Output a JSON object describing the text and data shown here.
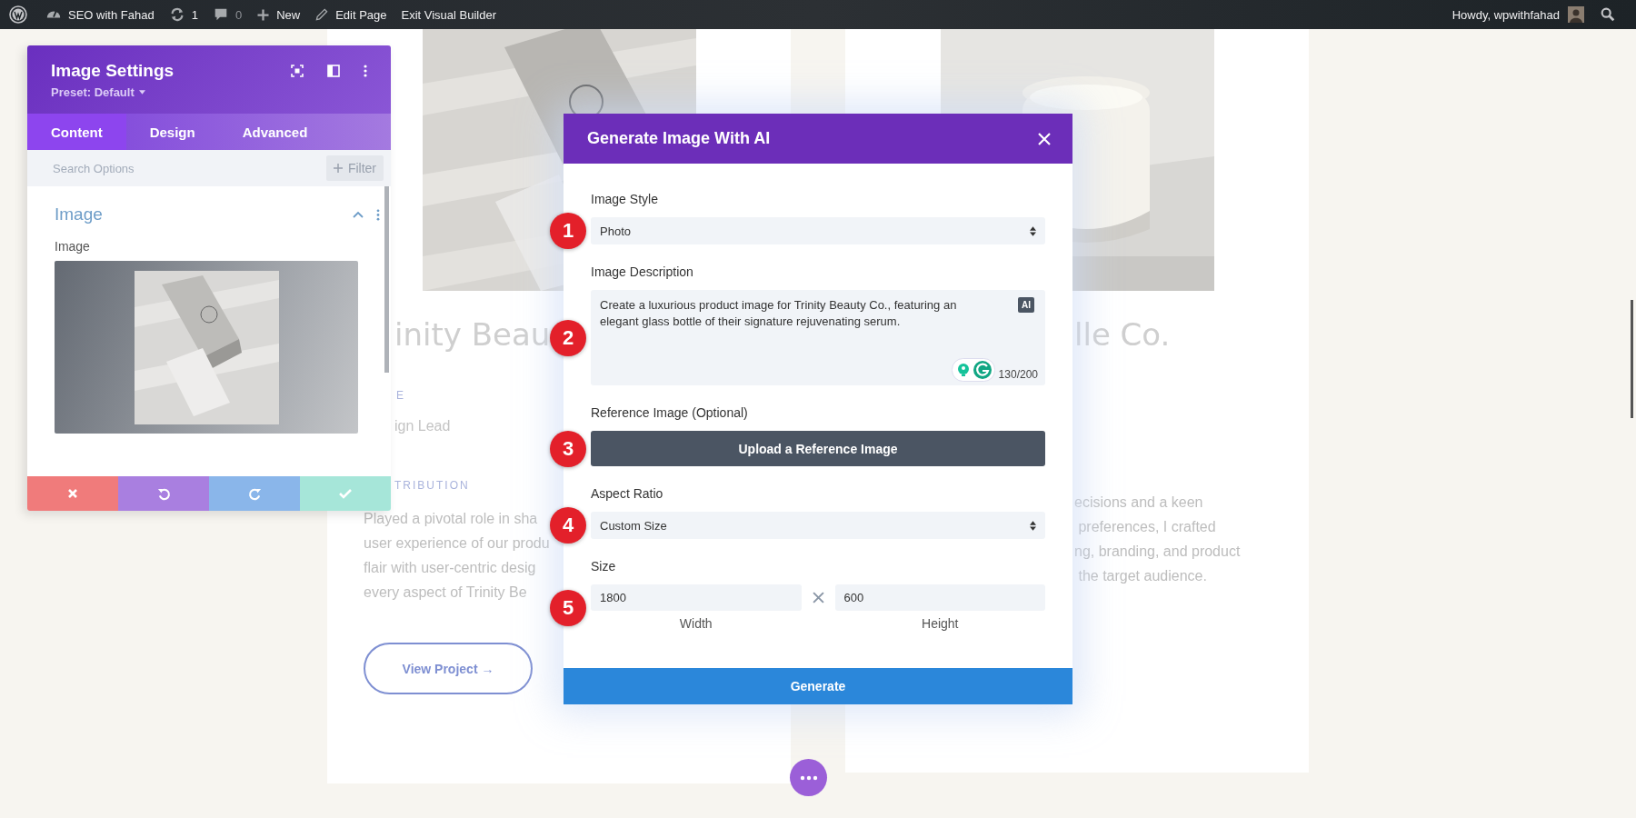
{
  "admin_bar": {
    "items": [
      {
        "kind": "site",
        "label": "SEO with Fahad",
        "disabled": false
      },
      {
        "kind": "updates",
        "label": "1",
        "disabled": false
      },
      {
        "kind": "comments",
        "label": "0",
        "disabled": true
      },
      {
        "kind": "new",
        "label": "New",
        "disabled": false
      },
      {
        "kind": "edit",
        "label": "Edit Page",
        "disabled": false
      },
      {
        "kind": "exit",
        "label": "Exit Visual Builder",
        "disabled": false
      }
    ],
    "greeting": "Howdy, wpwithfahad"
  },
  "page": {
    "cards": [
      {
        "title": "inity Beau",
        "label": "E",
        "role": "ign Lead",
        "section": "TRIBUTION",
        "paragraph_lines": [
          "Played a pivotal role in sha",
          "user experience of our produ",
          "flair with user-centric desig",
          "every aspect of Trinity Be"
        ],
        "button": "View Project →"
      },
      {
        "title": "lle Co.",
        "paragraph_lines": [
          "ecisions and a keen",
          " preferences, I crafted",
          "ng, branding, and product",
          " the target audience."
        ]
      }
    ]
  },
  "settings_panel": {
    "title": "Image Settings",
    "preset": "Preset: Default",
    "tabs": [
      {
        "label": "Content",
        "selected": true
      },
      {
        "label": "Design",
        "selected": false
      },
      {
        "label": "Advanced",
        "selected": false
      }
    ],
    "search": {
      "placeholder": "Search Options"
    },
    "filter": "Filter",
    "section": {
      "title": "Image",
      "expanded": true
    },
    "field_label": "Image",
    "footer": [
      {
        "kind": "discard"
      },
      {
        "kind": "undo"
      },
      {
        "kind": "redo"
      },
      {
        "kind": "save"
      }
    ]
  },
  "modal": {
    "title": "Generate Image With AI",
    "fields": [
      {
        "kind": "select",
        "step": "1",
        "label": "Image Style",
        "value": "Photo"
      },
      {
        "kind": "textarea",
        "step": "2",
        "label": "Image Description",
        "value": "Create a luxurious product image for Trinity Beauty Co., featuring an elegant glass bottle of their signature rejuvenating serum.",
        "badge": "AI",
        "counter": "130/200"
      },
      {
        "kind": "upload",
        "step": "3",
        "label": "Reference Image (Optional)",
        "button": "Upload a Reference Image"
      },
      {
        "kind": "select",
        "step": "4",
        "label": "Aspect Ratio",
        "value": "Custom Size"
      },
      {
        "kind": "size",
        "step": "5",
        "label": "Size",
        "width": {
          "value": "1800",
          "caption": "Width"
        },
        "height": {
          "value": "600",
          "caption": "Height"
        }
      }
    ],
    "submit": "Generate"
  }
}
